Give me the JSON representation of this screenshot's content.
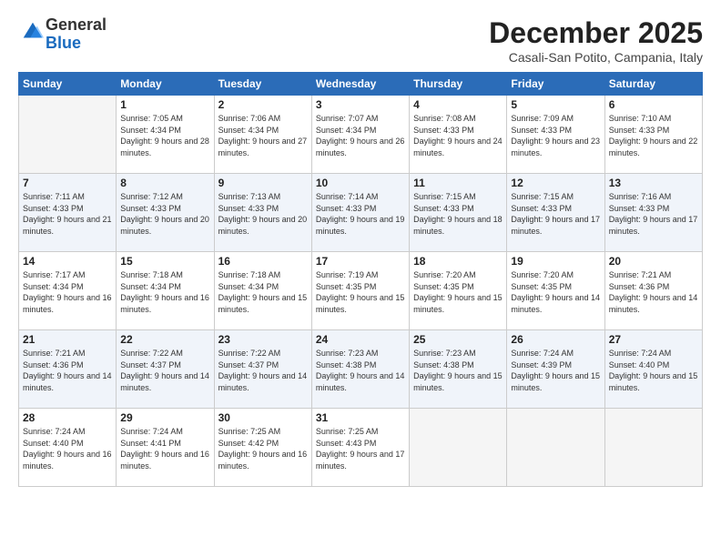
{
  "logo": {
    "general": "General",
    "blue": "Blue"
  },
  "header": {
    "month": "December 2025",
    "location": "Casali-San Potito, Campania, Italy"
  },
  "weekdays": [
    "Sunday",
    "Monday",
    "Tuesday",
    "Wednesday",
    "Thursday",
    "Friday",
    "Saturday"
  ],
  "weeks": [
    [
      {
        "day": "",
        "sunrise": "",
        "sunset": "",
        "daylight": ""
      },
      {
        "day": "1",
        "sunrise": "Sunrise: 7:05 AM",
        "sunset": "Sunset: 4:34 PM",
        "daylight": "Daylight: 9 hours and 28 minutes."
      },
      {
        "day": "2",
        "sunrise": "Sunrise: 7:06 AM",
        "sunset": "Sunset: 4:34 PM",
        "daylight": "Daylight: 9 hours and 27 minutes."
      },
      {
        "day": "3",
        "sunrise": "Sunrise: 7:07 AM",
        "sunset": "Sunset: 4:34 PM",
        "daylight": "Daylight: 9 hours and 26 minutes."
      },
      {
        "day": "4",
        "sunrise": "Sunrise: 7:08 AM",
        "sunset": "Sunset: 4:33 PM",
        "daylight": "Daylight: 9 hours and 24 minutes."
      },
      {
        "day": "5",
        "sunrise": "Sunrise: 7:09 AM",
        "sunset": "Sunset: 4:33 PM",
        "daylight": "Daylight: 9 hours and 23 minutes."
      },
      {
        "day": "6",
        "sunrise": "Sunrise: 7:10 AM",
        "sunset": "Sunset: 4:33 PM",
        "daylight": "Daylight: 9 hours and 22 minutes."
      }
    ],
    [
      {
        "day": "7",
        "sunrise": "Sunrise: 7:11 AM",
        "sunset": "Sunset: 4:33 PM",
        "daylight": "Daylight: 9 hours and 21 minutes."
      },
      {
        "day": "8",
        "sunrise": "Sunrise: 7:12 AM",
        "sunset": "Sunset: 4:33 PM",
        "daylight": "Daylight: 9 hours and 20 minutes."
      },
      {
        "day": "9",
        "sunrise": "Sunrise: 7:13 AM",
        "sunset": "Sunset: 4:33 PM",
        "daylight": "Daylight: 9 hours and 20 minutes."
      },
      {
        "day": "10",
        "sunrise": "Sunrise: 7:14 AM",
        "sunset": "Sunset: 4:33 PM",
        "daylight": "Daylight: 9 hours and 19 minutes."
      },
      {
        "day": "11",
        "sunrise": "Sunrise: 7:15 AM",
        "sunset": "Sunset: 4:33 PM",
        "daylight": "Daylight: 9 hours and 18 minutes."
      },
      {
        "day": "12",
        "sunrise": "Sunrise: 7:15 AM",
        "sunset": "Sunset: 4:33 PM",
        "daylight": "Daylight: 9 hours and 17 minutes."
      },
      {
        "day": "13",
        "sunrise": "Sunrise: 7:16 AM",
        "sunset": "Sunset: 4:33 PM",
        "daylight": "Daylight: 9 hours and 17 minutes."
      }
    ],
    [
      {
        "day": "14",
        "sunrise": "Sunrise: 7:17 AM",
        "sunset": "Sunset: 4:34 PM",
        "daylight": "Daylight: 9 hours and 16 minutes."
      },
      {
        "day": "15",
        "sunrise": "Sunrise: 7:18 AM",
        "sunset": "Sunset: 4:34 PM",
        "daylight": "Daylight: 9 hours and 16 minutes."
      },
      {
        "day": "16",
        "sunrise": "Sunrise: 7:18 AM",
        "sunset": "Sunset: 4:34 PM",
        "daylight": "Daylight: 9 hours and 15 minutes."
      },
      {
        "day": "17",
        "sunrise": "Sunrise: 7:19 AM",
        "sunset": "Sunset: 4:35 PM",
        "daylight": "Daylight: 9 hours and 15 minutes."
      },
      {
        "day": "18",
        "sunrise": "Sunrise: 7:20 AM",
        "sunset": "Sunset: 4:35 PM",
        "daylight": "Daylight: 9 hours and 15 minutes."
      },
      {
        "day": "19",
        "sunrise": "Sunrise: 7:20 AM",
        "sunset": "Sunset: 4:35 PM",
        "daylight": "Daylight: 9 hours and 14 minutes."
      },
      {
        "day": "20",
        "sunrise": "Sunrise: 7:21 AM",
        "sunset": "Sunset: 4:36 PM",
        "daylight": "Daylight: 9 hours and 14 minutes."
      }
    ],
    [
      {
        "day": "21",
        "sunrise": "Sunrise: 7:21 AM",
        "sunset": "Sunset: 4:36 PM",
        "daylight": "Daylight: 9 hours and 14 minutes."
      },
      {
        "day": "22",
        "sunrise": "Sunrise: 7:22 AM",
        "sunset": "Sunset: 4:37 PM",
        "daylight": "Daylight: 9 hours and 14 minutes."
      },
      {
        "day": "23",
        "sunrise": "Sunrise: 7:22 AM",
        "sunset": "Sunset: 4:37 PM",
        "daylight": "Daylight: 9 hours and 14 minutes."
      },
      {
        "day": "24",
        "sunrise": "Sunrise: 7:23 AM",
        "sunset": "Sunset: 4:38 PM",
        "daylight": "Daylight: 9 hours and 14 minutes."
      },
      {
        "day": "25",
        "sunrise": "Sunrise: 7:23 AM",
        "sunset": "Sunset: 4:38 PM",
        "daylight": "Daylight: 9 hours and 15 minutes."
      },
      {
        "day": "26",
        "sunrise": "Sunrise: 7:24 AM",
        "sunset": "Sunset: 4:39 PM",
        "daylight": "Daylight: 9 hours and 15 minutes."
      },
      {
        "day": "27",
        "sunrise": "Sunrise: 7:24 AM",
        "sunset": "Sunset: 4:40 PM",
        "daylight": "Daylight: 9 hours and 15 minutes."
      }
    ],
    [
      {
        "day": "28",
        "sunrise": "Sunrise: 7:24 AM",
        "sunset": "Sunset: 4:40 PM",
        "daylight": "Daylight: 9 hours and 16 minutes."
      },
      {
        "day": "29",
        "sunrise": "Sunrise: 7:24 AM",
        "sunset": "Sunset: 4:41 PM",
        "daylight": "Daylight: 9 hours and 16 minutes."
      },
      {
        "day": "30",
        "sunrise": "Sunrise: 7:25 AM",
        "sunset": "Sunset: 4:42 PM",
        "daylight": "Daylight: 9 hours and 16 minutes."
      },
      {
        "day": "31",
        "sunrise": "Sunrise: 7:25 AM",
        "sunset": "Sunset: 4:43 PM",
        "daylight": "Daylight: 9 hours and 17 minutes."
      },
      {
        "day": "",
        "sunrise": "",
        "sunset": "",
        "daylight": ""
      },
      {
        "day": "",
        "sunrise": "",
        "sunset": "",
        "daylight": ""
      },
      {
        "day": "",
        "sunrise": "",
        "sunset": "",
        "daylight": ""
      }
    ]
  ]
}
